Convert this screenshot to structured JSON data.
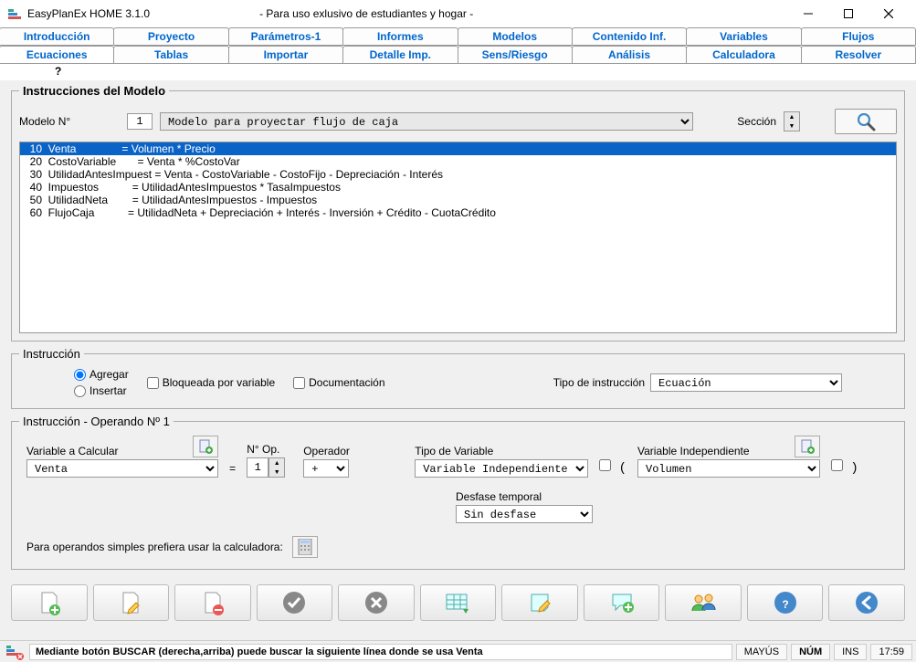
{
  "titlebar": {
    "app_name": "EasyPlanEx HOME 3.1.0",
    "subtitle": "- Para uso exlusivo de estudiantes y hogar -"
  },
  "tabs_row1": [
    "Introducción",
    "Proyecto",
    "Parámetros-1",
    "Informes",
    "Modelos",
    "Contenido Inf.",
    "Variables",
    "Flujos"
  ],
  "tabs_row2": [
    "Ecuaciones",
    "Tablas",
    "Importar",
    "Detalle Imp.",
    "Sens/Riesgo",
    "Análisis",
    "Calculadora",
    "Resolver"
  ],
  "help_label": "?",
  "instrucciones": {
    "title": "Instrucciones del Modelo",
    "modelo_label": "Modelo N°",
    "modelo_num": "1",
    "modelo_name": "Modelo para proyectar flujo de caja",
    "seccion_label": "Sección",
    "lines": [
      {
        "n": "10",
        "txt": "  10  Venta               = Volumen * Precio",
        "sel": true
      },
      {
        "n": "20",
        "txt": "  20  CostoVariable       = Venta * %CostoVar"
      },
      {
        "n": "30",
        "txt": "  30  UtilidadAntesImpuest = Venta - CostoVariable - CostoFijo - Depreciación - Interés"
      },
      {
        "n": "40",
        "txt": "  40  Impuestos           = UtilidadAntesImpuestos * TasaImpuestos"
      },
      {
        "n": "50",
        "txt": "  50  UtilidadNeta        = UtilidadAntesImpuestos - Impuestos"
      },
      {
        "n": "60",
        "txt": "  60  FlujoCaja           = UtilidadNeta + Depreciación + Interés - Inversión + Crédito - CuotaCrédito"
      }
    ]
  },
  "instruccion": {
    "legend": "Instrucción",
    "agregar": "Agregar",
    "insertar": "Insertar",
    "bloqueada": "Bloqueada por variable",
    "documentacion": "Documentación",
    "tipo_label": "Tipo de  instrucción",
    "tipo_value": "Ecuación"
  },
  "operando": {
    "legend": "Instrucción - Operando Nº 1",
    "var_calc_label": "Variable a Calcular",
    "var_calc_value": "Venta",
    "nop_label": "N° Op.",
    "nop_value": "1",
    "operador_label": "Operador",
    "operador_value": "+",
    "tipo_var_label": "Tipo de Variable",
    "tipo_var_value": "Variable Independiente",
    "var_ind_label": "Variable Independiente",
    "var_ind_value": "Volumen",
    "desfase_label": "Desfase temporal",
    "desfase_value": "Sin desfase",
    "calc_hint": "Para operandos simples prefiera usar la calculadora:"
  },
  "statusbar": {
    "msg": "Mediante botón BUSCAR (derecha,arriba) puede buscar la siguiente línea donde se usa Venta",
    "mayus": "MAYÚS",
    "num": "NÚM",
    "ins": "INS",
    "time": "17:59"
  }
}
